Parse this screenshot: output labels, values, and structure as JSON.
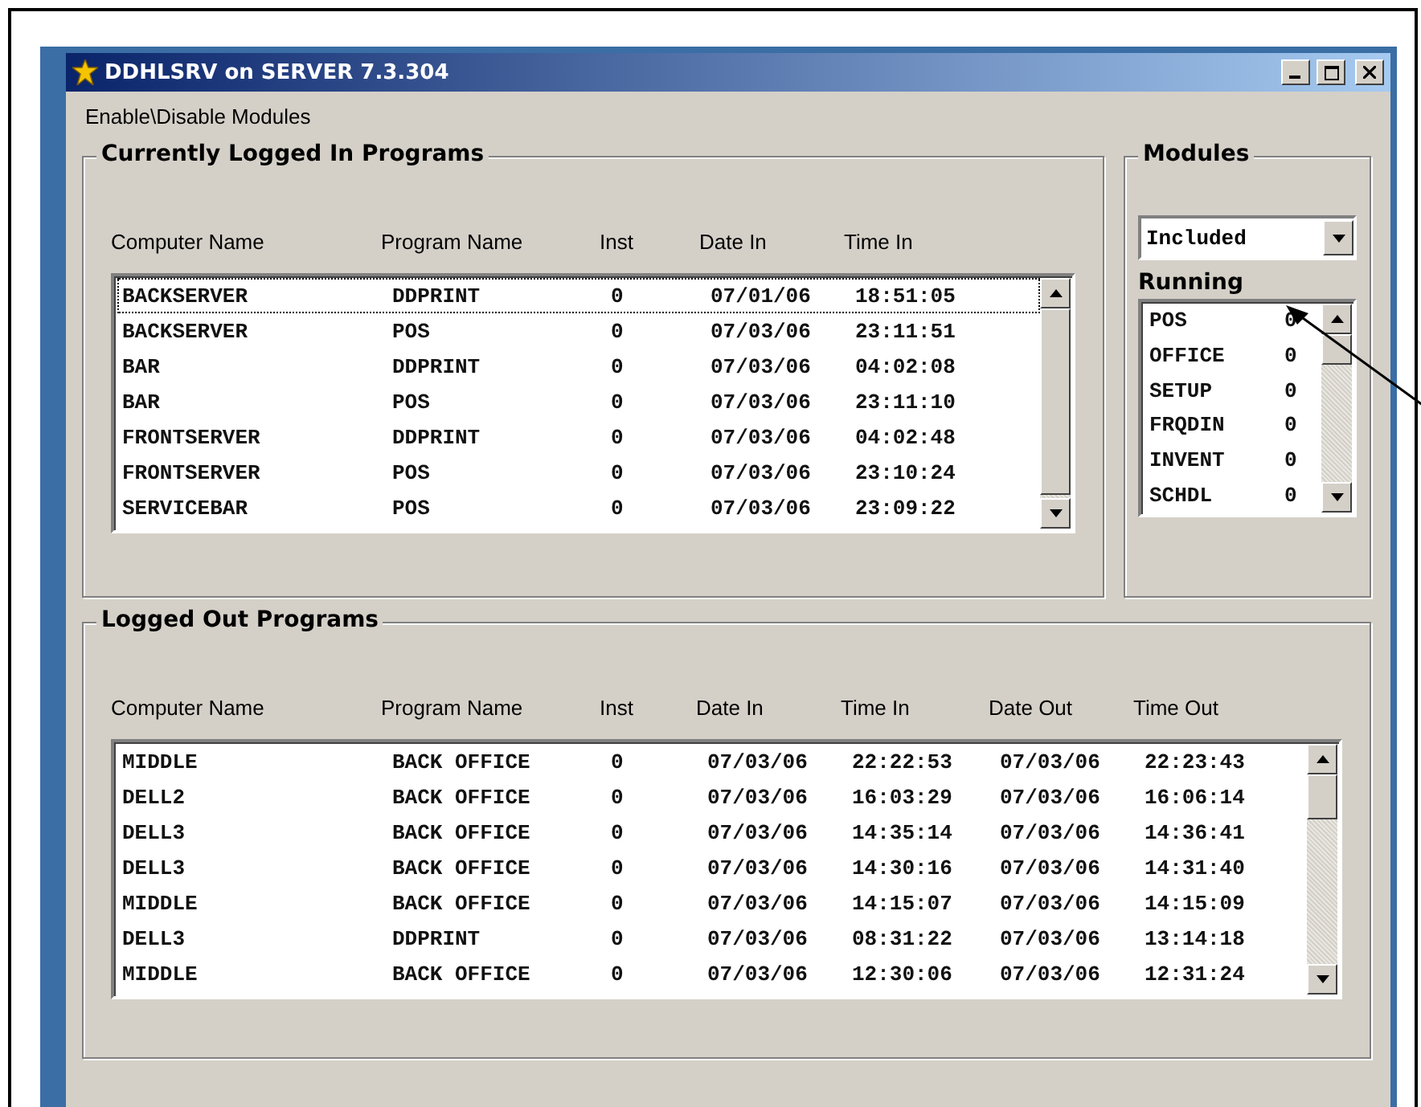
{
  "window": {
    "title": "DDHLSRV on SERVER 7.3.304"
  },
  "menu": [
    {
      "label": "Enable\\Disable Modules"
    }
  ],
  "logged_in": {
    "title": "Currently Logged In Programs",
    "columns": [
      "Computer Name",
      "Program Name",
      "Inst",
      "Date In",
      "Time In"
    ],
    "rows": [
      {
        "cells": [
          "BACKSERVER",
          "DDPRINT",
          "0",
          "07/01/06",
          "18:51:05"
        ],
        "selected": true
      },
      {
        "cells": [
          "BACKSERVER",
          "POS",
          "0",
          "07/03/06",
          "23:11:51"
        ],
        "selected": false
      },
      {
        "cells": [
          "BAR",
          "DDPRINT",
          "0",
          "07/03/06",
          "04:02:08"
        ],
        "selected": false
      },
      {
        "cells": [
          "BAR",
          "POS",
          "0",
          "07/03/06",
          "23:11:10"
        ],
        "selected": false
      },
      {
        "cells": [
          "FRONTSERVER",
          "DDPRINT",
          "0",
          "07/03/06",
          "04:02:48"
        ],
        "selected": false
      },
      {
        "cells": [
          "FRONTSERVER",
          "POS",
          "0",
          "07/03/06",
          "23:10:24"
        ],
        "selected": false
      },
      {
        "cells": [
          "SERVICEBAR",
          "POS",
          "0",
          "07/03/06",
          "23:09:22"
        ],
        "selected": false
      }
    ]
  },
  "modules": {
    "title": "Modules",
    "filter": "Included",
    "running_label": "Running",
    "running": [
      {
        "name": "POS",
        "count": "0"
      },
      {
        "name": "OFFICE",
        "count": "0"
      },
      {
        "name": "SETUP",
        "count": "0"
      },
      {
        "name": "FRQDIN",
        "count": "0"
      },
      {
        "name": "INVENT",
        "count": "0"
      },
      {
        "name": "SCHDL",
        "count": "0"
      }
    ]
  },
  "logged_out": {
    "title": "Logged Out Programs",
    "columns": [
      "Computer Name",
      "Program Name",
      "Inst",
      "Date In",
      "Time In",
      "Date Out",
      "Time Out"
    ],
    "rows": [
      {
        "cells": [
          "MIDDLE",
          "BACK OFFICE",
          "0",
          "07/03/06",
          "22:22:53",
          "07/03/06",
          "22:23:43"
        ]
      },
      {
        "cells": [
          "DELL2",
          "BACK OFFICE",
          "0",
          "07/03/06",
          "16:03:29",
          "07/03/06",
          "16:06:14"
        ]
      },
      {
        "cells": [
          "DELL3",
          "BACK OFFICE",
          "0",
          "07/03/06",
          "14:35:14",
          "07/03/06",
          "14:36:41"
        ]
      },
      {
        "cells": [
          "DELL3",
          "BACK OFFICE",
          "0",
          "07/03/06",
          "14:30:16",
          "07/03/06",
          "14:31:40"
        ]
      },
      {
        "cells": [
          "MIDDLE",
          "BACK OFFICE",
          "0",
          "07/03/06",
          "14:15:07",
          "07/03/06",
          "14:15:09"
        ]
      },
      {
        "cells": [
          "DELL3",
          "DDPRINT",
          "0",
          "07/03/06",
          "08:31:22",
          "07/03/06",
          "13:14:18"
        ]
      },
      {
        "cells": [
          "MIDDLE",
          "BACK OFFICE",
          "0",
          "07/03/06",
          "12:30:06",
          "07/03/06",
          "12:31:24"
        ]
      }
    ]
  }
}
